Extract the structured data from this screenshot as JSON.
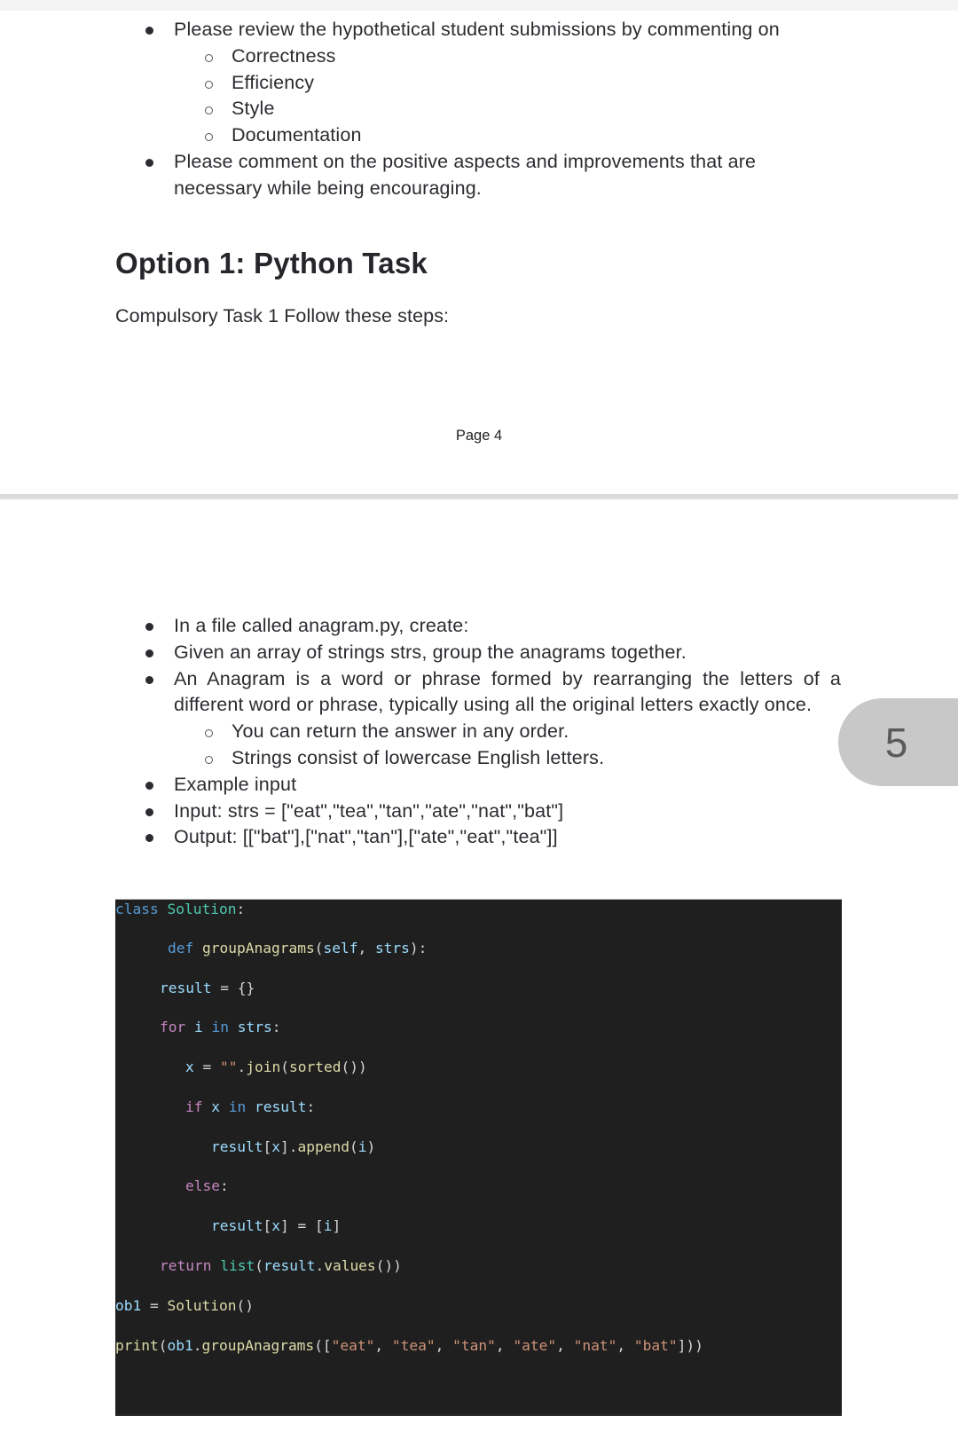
{
  "page4": {
    "review_list": [
      {
        "text": "Please review the hypothetical student submissions by commenting on",
        "children": [
          "Correctness",
          "Efficiency",
          "Style",
          "Documentation"
        ]
      },
      {
        "text": "Please comment on the positive aspects and improvements that are necessary while being encouraging.",
        "children": []
      }
    ],
    "heading": "Option 1: Python Task",
    "subtext": "Compulsory Task 1 Follow these steps:",
    "page_label": "Page 4"
  },
  "page5": {
    "side_tab_number": "5",
    "task_list": [
      {
        "text": "In a file called anagram.py, create:",
        "children": []
      },
      {
        "text": "Given an array of strings strs, group the anagrams together.",
        "children": []
      },
      {
        "text": "An Anagram is a word or phrase formed by rearranging the letters of a different word or phrase, typically using all the original letters exactly once.",
        "children": [
          "You can return the answer in any order.",
          "Strings consist of lowercase English letters."
        ]
      },
      {
        "text": "Example input",
        "children": []
      },
      {
        "text": "Input: strs = [\"eat\",\"tea\",\"tan\",\"ate\",\"nat\",\"bat\"]",
        "children": []
      },
      {
        "text": "Output: [[\"bat\"],[\"nat\",\"tan\"],[\"ate\",\"eat\",\"tea\"]]",
        "children": []
      }
    ],
    "code": {
      "background": "#1f1f1f",
      "lines": [
        [
          [
            "kw",
            "class"
          ],
          [
            "punc",
            " "
          ],
          [
            "cls",
            "Solution"
          ],
          [
            "punc",
            ":"
          ]
        ],
        [
          [
            "kw",
            "def"
          ],
          [
            "punc",
            " "
          ],
          [
            "fn",
            "groupAnagrams"
          ],
          [
            "punc",
            "("
          ],
          [
            "var",
            "self"
          ],
          [
            "punc",
            ", "
          ],
          [
            "var",
            "strs"
          ],
          [
            "punc",
            "):"
          ]
        ],
        [
          [
            "var",
            "result"
          ],
          [
            "op",
            " = "
          ],
          [
            "punc",
            "{}"
          ]
        ],
        [
          [
            "ctrl",
            "for"
          ],
          [
            "punc",
            " "
          ],
          [
            "var",
            "i"
          ],
          [
            "punc",
            " "
          ],
          [
            "kw",
            "in"
          ],
          [
            "punc",
            " "
          ],
          [
            "var",
            "strs"
          ],
          [
            "punc",
            ":"
          ]
        ],
        [
          [
            "var",
            "x"
          ],
          [
            "op",
            " = "
          ],
          [
            "str",
            "\"\""
          ],
          [
            "punc",
            "."
          ],
          [
            "fn",
            "join"
          ],
          [
            "punc",
            "("
          ],
          [
            "fn",
            "sorted"
          ],
          [
            "punc",
            "())"
          ]
        ],
        [
          [
            "ctrl",
            "if"
          ],
          [
            "punc",
            " "
          ],
          [
            "var",
            "x"
          ],
          [
            "punc",
            " "
          ],
          [
            "kw",
            "in"
          ],
          [
            "punc",
            " "
          ],
          [
            "var",
            "result"
          ],
          [
            "punc",
            ":"
          ]
        ],
        [
          [
            "var",
            "result"
          ],
          [
            "punc",
            "["
          ],
          [
            "var",
            "x"
          ],
          [
            "punc",
            "]."
          ],
          [
            "fn",
            "append"
          ],
          [
            "punc",
            "("
          ],
          [
            "var",
            "i"
          ],
          [
            "punc",
            ")"
          ]
        ],
        [
          [
            "ctrl",
            "else"
          ],
          [
            "punc",
            ":"
          ]
        ],
        [
          [
            "var",
            "result"
          ],
          [
            "punc",
            "["
          ],
          [
            "var",
            "x"
          ],
          [
            "punc",
            "]"
          ],
          [
            "op",
            " = "
          ],
          [
            "punc",
            "["
          ],
          [
            "var",
            "i"
          ],
          [
            "punc",
            "]"
          ]
        ],
        [
          [
            "ctrl",
            "return"
          ],
          [
            "punc",
            " "
          ],
          [
            "builtin",
            "list"
          ],
          [
            "punc",
            "("
          ],
          [
            "var",
            "result"
          ],
          [
            "punc",
            "."
          ],
          [
            "fn",
            "values"
          ],
          [
            "punc",
            "())"
          ]
        ],
        [
          [
            "var",
            "ob1"
          ],
          [
            "op",
            " = "
          ],
          [
            "fn",
            "Solution"
          ],
          [
            "punc",
            "()"
          ]
        ],
        [
          [
            "fn",
            "print"
          ],
          [
            "punc",
            "("
          ],
          [
            "var",
            "ob1"
          ],
          [
            "punc",
            "."
          ],
          [
            "fn",
            "groupAnagrams"
          ],
          [
            "punc",
            "(["
          ],
          [
            "str",
            "\"eat\""
          ],
          [
            "punc",
            ", "
          ],
          [
            "str",
            "\"tea\""
          ],
          [
            "punc",
            ", "
          ],
          [
            "str",
            "\"tan\""
          ],
          [
            "punc",
            ", "
          ],
          [
            "str",
            "\"ate\""
          ],
          [
            "punc",
            ", "
          ],
          [
            "str",
            "\"nat\""
          ],
          [
            "punc",
            ", "
          ],
          [
            "str",
            "\"bat\""
          ],
          [
            "punc",
            "]))"
          ]
        ]
      ]
    }
  }
}
